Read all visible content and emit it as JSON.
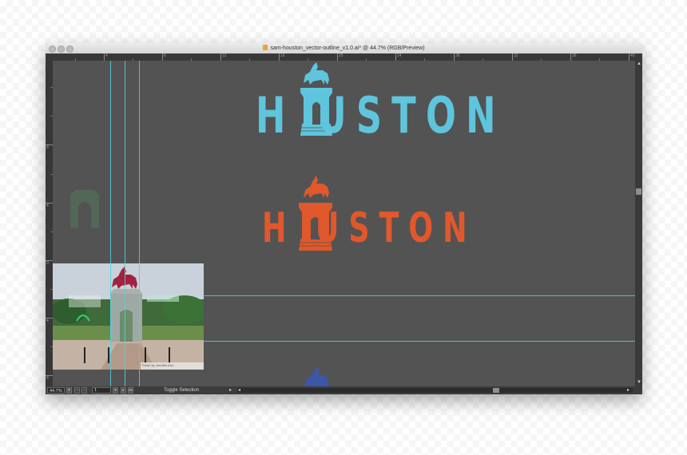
{
  "window": {
    "title": "sam-houston_vector-outline_v1.0.ai* @ 44.7% (RGB/Preview)"
  },
  "rulers": {
    "horizontal_labels": [
      "4",
      "8",
      "12",
      "16",
      "20",
      "24",
      "28",
      "32",
      "36",
      "40"
    ],
    "vertical_labels": [
      "8",
      "4",
      "0",
      "4",
      "8"
    ]
  },
  "artboard": {
    "logo_top_text": "H  USTON",
    "logo_bottom_text": "H  USTON",
    "photo_credit": "Photo by Jennifer Ann"
  },
  "colors": {
    "logo_top": "#5ec5dc",
    "logo_bottom": "#e0582c",
    "horse_photo": "#a3213f",
    "guides": "#4fd3e0",
    "faded_monument": "#4f7a57",
    "bottom_horse": "#3d57a8"
  },
  "statusbar": {
    "zoom": "44.7%",
    "page": "1",
    "toggle_label": "Toggle Selection"
  },
  "icons": {
    "close": "close-button-icon",
    "minimize": "minimize-button-icon",
    "zoom": "zoom-button-icon",
    "document": "illustrator-document-icon"
  }
}
